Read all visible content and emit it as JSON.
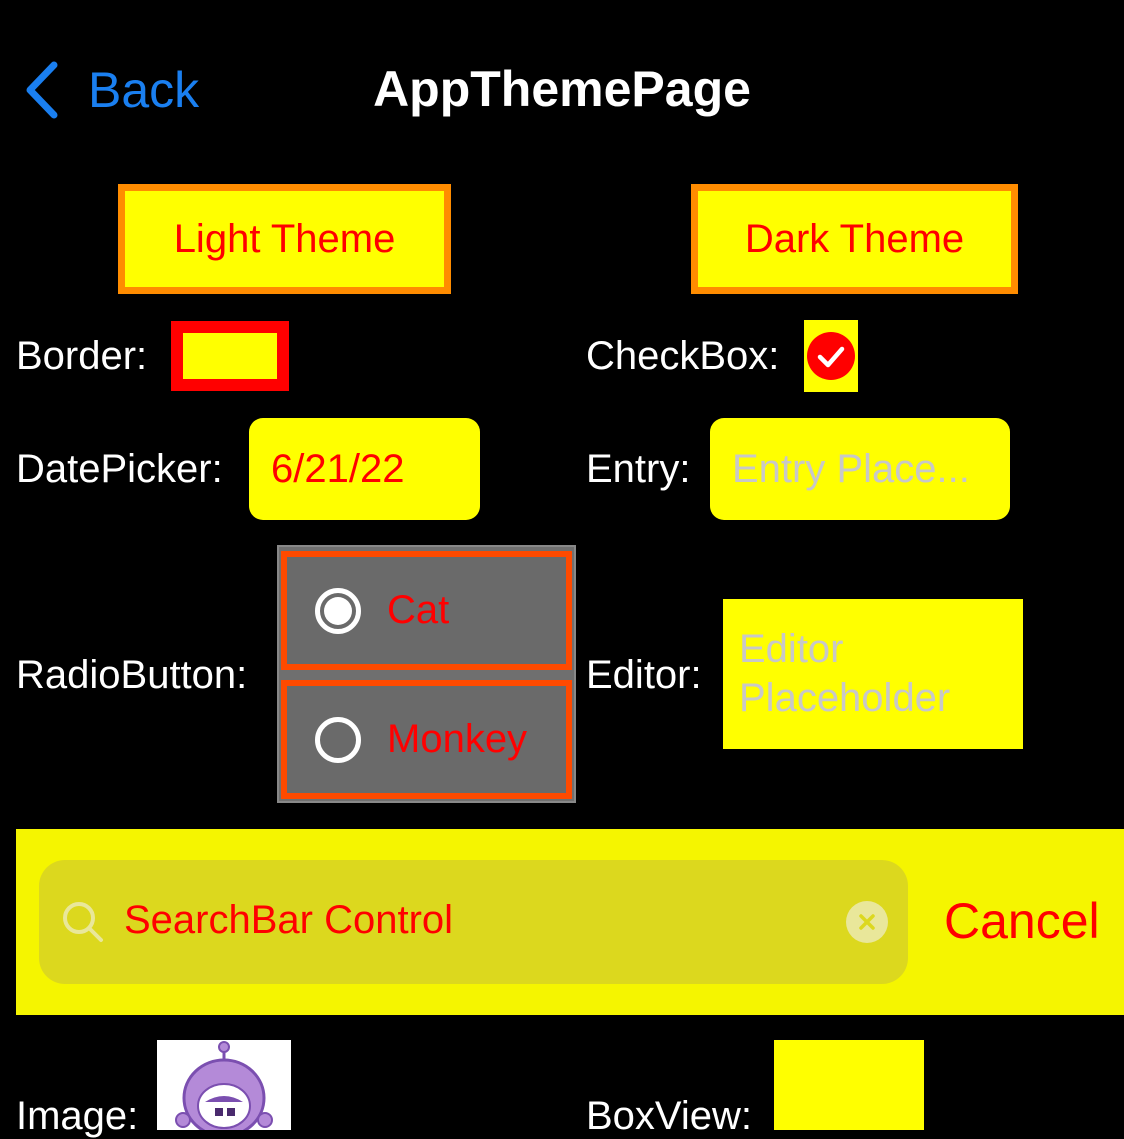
{
  "nav": {
    "back_label": "Back",
    "title": "AppThemePage"
  },
  "theme_buttons": {
    "light": "Light Theme",
    "dark": "Dark Theme"
  },
  "labels": {
    "border": "Border:",
    "checkbox": "CheckBox:",
    "datepicker": "DatePicker:",
    "entry": "Entry:",
    "radiobutton": "RadioButton:",
    "editor": "Editor:",
    "image": "Image:",
    "boxview": "BoxView:"
  },
  "checkbox": {
    "checked": true
  },
  "datepicker": {
    "value": "6/21/22"
  },
  "entry": {
    "placeholder": "Entry Place..."
  },
  "radio": {
    "options": [
      {
        "label": "Cat",
        "selected": true
      },
      {
        "label": "Monkey",
        "selected": false
      }
    ]
  },
  "editor": {
    "placeholder_line1": "Editor",
    "placeholder_line2": "Placeholder"
  },
  "search": {
    "text": "SearchBar Control",
    "cancel_label": "Cancel"
  },
  "colors": {
    "accent_yellow": "#ffff00",
    "text_red": "#ff0000",
    "button_border_orange": "#ff8c00",
    "radio_border": "#ff4a00",
    "ios_blue": "#1a7ff0"
  }
}
